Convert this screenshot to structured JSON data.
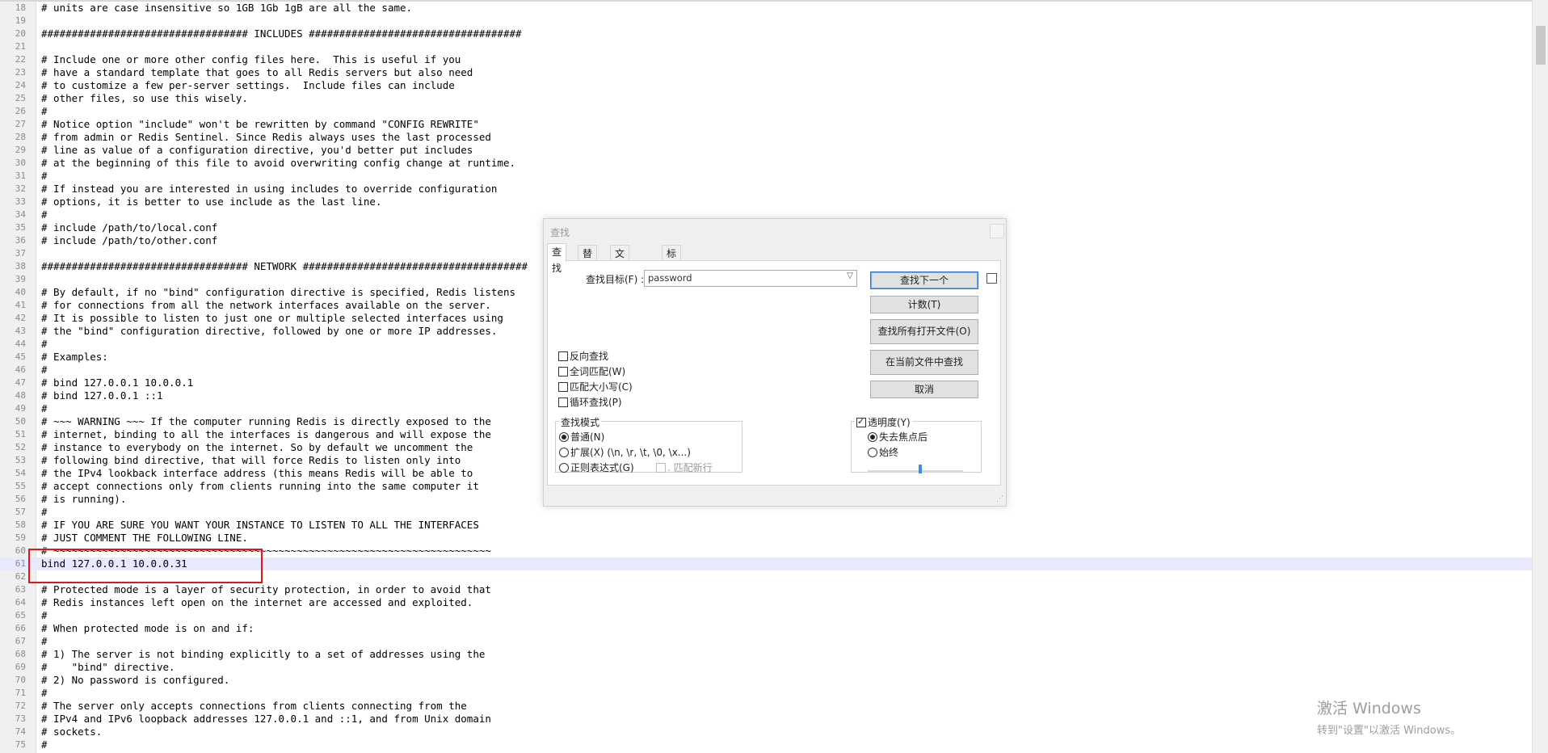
{
  "editor": {
    "lines": [
      {
        "num": "18",
        "text": "# units are case insensitive so 1GB 1Gb 1gB are all the same."
      },
      {
        "num": "19",
        "text": ""
      },
      {
        "num": "20",
        "text": "################################## INCLUDES ###################################"
      },
      {
        "num": "21",
        "text": ""
      },
      {
        "num": "22",
        "text": "# Include one or more other config files here.  This is useful if you"
      },
      {
        "num": "23",
        "text": "# have a standard template that goes to all Redis servers but also need"
      },
      {
        "num": "24",
        "text": "# to customize a few per-server settings.  Include files can include"
      },
      {
        "num": "25",
        "text": "# other files, so use this wisely."
      },
      {
        "num": "26",
        "text": "#"
      },
      {
        "num": "27",
        "text": "# Notice option \"include\" won't be rewritten by command \"CONFIG REWRITE\""
      },
      {
        "num": "28",
        "text": "# from admin or Redis Sentinel. Since Redis always uses the last processed"
      },
      {
        "num": "29",
        "text": "# line as value of a configuration directive, you'd better put includes"
      },
      {
        "num": "30",
        "text": "# at the beginning of this file to avoid overwriting config change at runtime."
      },
      {
        "num": "31",
        "text": "#"
      },
      {
        "num": "32",
        "text": "# If instead you are interested in using includes to override configuration"
      },
      {
        "num": "33",
        "text": "# options, it is better to use include as the last line."
      },
      {
        "num": "34",
        "text": "#"
      },
      {
        "num": "35",
        "text": "# include /path/to/local.conf"
      },
      {
        "num": "36",
        "text": "# include /path/to/other.conf"
      },
      {
        "num": "37",
        "text": ""
      },
      {
        "num": "38",
        "text": "################################## NETWORK #####################################"
      },
      {
        "num": "39",
        "text": ""
      },
      {
        "num": "40",
        "text": "# By default, if no \"bind\" configuration directive is specified, Redis listens"
      },
      {
        "num": "41",
        "text": "# for connections from all the network interfaces available on the server."
      },
      {
        "num": "42",
        "text": "# It is possible to listen to just one or multiple selected interfaces using"
      },
      {
        "num": "43",
        "text": "# the \"bind\" configuration directive, followed by one or more IP addresses."
      },
      {
        "num": "44",
        "text": "#"
      },
      {
        "num": "45",
        "text": "# Examples:"
      },
      {
        "num": "46",
        "text": "#"
      },
      {
        "num": "47",
        "text": "# bind 127.0.0.1 10.0.0.1"
      },
      {
        "num": "48",
        "text": "# bind 127.0.0.1 ::1"
      },
      {
        "num": "49",
        "text": "#"
      },
      {
        "num": "50",
        "text": "# ~~~ WARNING ~~~ If the computer running Redis is directly exposed to the"
      },
      {
        "num": "51",
        "text": "# internet, binding to all the interfaces is dangerous and will expose the"
      },
      {
        "num": "52",
        "text": "# instance to everybody on the internet. So by default we uncomment the"
      },
      {
        "num": "53",
        "text": "# following bind directive, that will force Redis to listen only into"
      },
      {
        "num": "54",
        "text": "# the IPv4 lookback interface address (this means Redis will be able to"
      },
      {
        "num": "55",
        "text": "# accept connections only from clients running into the same computer it"
      },
      {
        "num": "56",
        "text": "# is running)."
      },
      {
        "num": "57",
        "text": "#"
      },
      {
        "num": "58",
        "text": "# IF YOU ARE SURE YOU WANT YOUR INSTANCE TO LISTEN TO ALL THE INTERFACES"
      },
      {
        "num": "59",
        "text": "# JUST COMMENT THE FOLLOWING LINE."
      },
      {
        "num": "60",
        "text": "# ~~~~~~~~~~~~~~~~~~~~~~~~~~~~~~~~~~~~~~~~~~~~~~~~~~~~~~~~~~~~~~~~~~~~~~~~"
      },
      {
        "num": "61",
        "text": "bind 127.0.0.1 10.0.0.31"
      },
      {
        "num": "62",
        "text": ""
      },
      {
        "num": "63",
        "text": "# Protected mode is a layer of security protection, in order to avoid that"
      },
      {
        "num": "64",
        "text": "# Redis instances left open on the internet are accessed and exploited."
      },
      {
        "num": "65",
        "text": "#"
      },
      {
        "num": "66",
        "text": "# When protected mode is on and if:"
      },
      {
        "num": "67",
        "text": "#"
      },
      {
        "num": "68",
        "text": "# 1) The server is not binding explicitly to a set of addresses using the"
      },
      {
        "num": "69",
        "text": "#    \"bind\" directive."
      },
      {
        "num": "70",
        "text": "# 2) No password is configured."
      },
      {
        "num": "71",
        "text": "#"
      },
      {
        "num": "72",
        "text": "# The server only accepts connections from clients connecting from the"
      },
      {
        "num": "73",
        "text": "# IPv4 and IPv6 loopback addresses 127.0.0.1 and ::1, and from Unix domain"
      },
      {
        "num": "74",
        "text": "# sockets."
      },
      {
        "num": "75",
        "text": "#"
      }
    ],
    "current_line": "61"
  },
  "dialog": {
    "title": "查找",
    "tabs": [
      "查找",
      "替换",
      "文件查找",
      "标记"
    ],
    "find_label": "查找目标(F) :",
    "find_value": "password",
    "buttons": {
      "find_next": "查找下一个",
      "count": "计数(T)",
      "find_all_open": "查找所有打开文件(O)",
      "find_in_current": "在当前文件中查找",
      "cancel": "取消"
    },
    "options": {
      "backward": "反向查找",
      "whole_word": "全词匹配(W)",
      "match_case": "匹配大小写(C)",
      "wrap": "循环查找(P)"
    },
    "search_mode": {
      "title": "查找模式",
      "normal": "普通(N)",
      "extended": "扩展(X) (\\n, \\r, \\t, \\0, \\x...)",
      "regex": "正则表达式(G)",
      "dot_newline": ". 匹配新行"
    },
    "transparency": {
      "title": "透明度(Y)",
      "on_lose_focus": "失去焦点后",
      "always": "始终",
      "level": 0.55
    }
  },
  "watermark": {
    "line1": "激活 Windows",
    "line2": "转到\"设置\"以激活 Windows。"
  }
}
